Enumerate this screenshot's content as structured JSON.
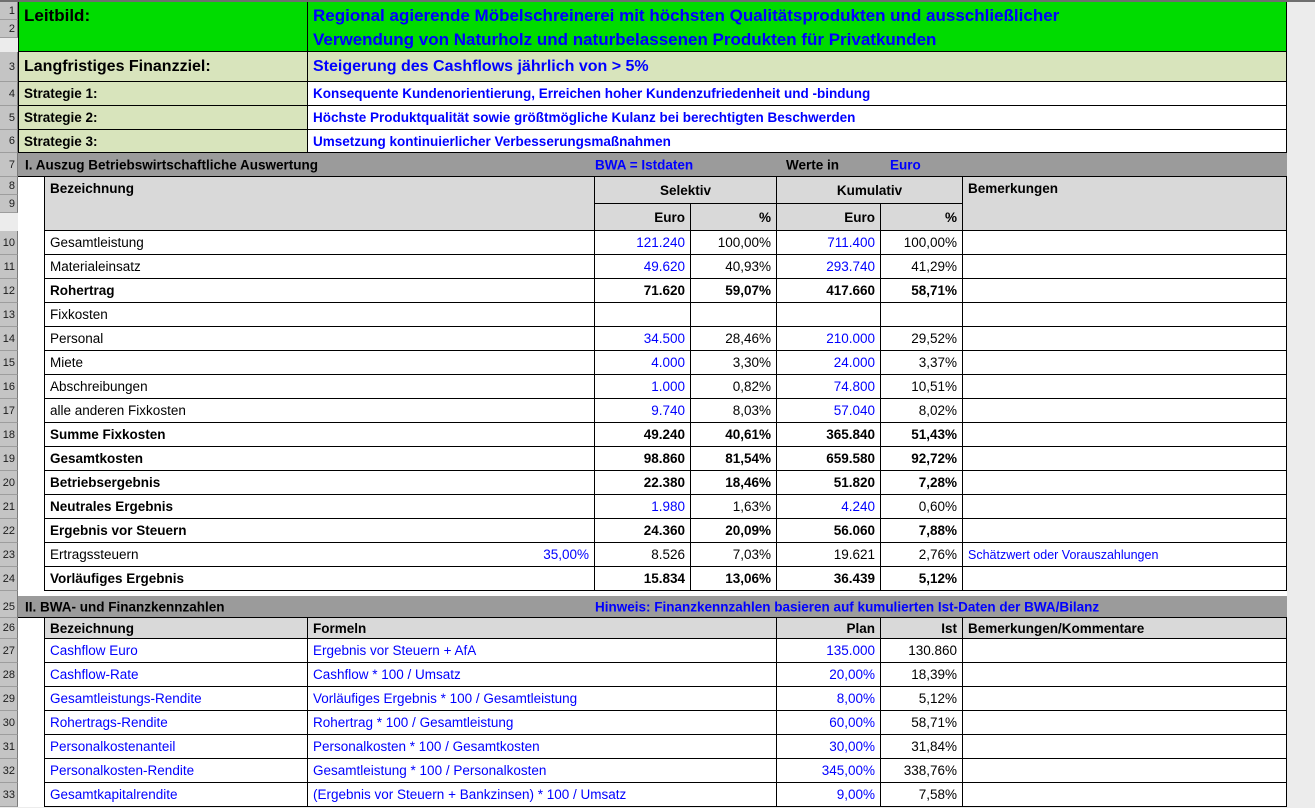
{
  "gutter": {
    "rows": [
      "1",
      "2",
      "3",
      "4",
      "5",
      "6",
      "7",
      "8",
      "9",
      "10",
      "11",
      "12",
      "13",
      "14",
      "15",
      "16",
      "17",
      "18",
      "19",
      "20",
      "21",
      "22",
      "23",
      "24",
      "25",
      "26",
      "27",
      "28",
      "29",
      "30",
      "31",
      "32",
      "33"
    ]
  },
  "colors": {
    "bright_green": "#00DC00",
    "light_green": "#D8E4BC",
    "section_bar_gray": "#9B9B9B",
    "table_header_gray": "#D9D9D9",
    "accent_blue": "#0000FF"
  },
  "top": {
    "leitbild": {
      "label": "Leitbild:",
      "line1": "Regional agierende Möbelschreinerei mit höchsten Qualitätsprodukten und ausschließlicher",
      "line2": "Verwendung von Naturholz und naturbelassenen Produkten für Privatkunden"
    },
    "finanzziel": {
      "label": "Langfristiges Finanzziel:",
      "text": "Steigerung des Cashflows jährlich von > 5%"
    },
    "strategien": [
      {
        "label": "Strategie 1:",
        "text": "Konsequente Kundenorientierung, Erreichen hoher Kundenzufriedenheit und -bindung"
      },
      {
        "label": "Strategie 2:",
        "text": "Höchste Produktqualität sowie größtmögliche Kulanz bei berechtigten Beschwerden"
      },
      {
        "label": "Strategie 3:",
        "text": "Umsetzung kontinuierlicher Verbesserungsmaßnahmen"
      }
    ]
  },
  "section1": {
    "title": "I. Auszug Betriebswirtschaftliche Auswertung",
    "note": "BWA = Istdaten",
    "werte_in_label": "Werte in",
    "werte_in_value": "Euro",
    "col_bezeichnung": "Bezeichnung",
    "col_selektiv": "Selektiv",
    "col_kumulativ": "Kumulativ",
    "col_bemerkungen": "Bemerkungen",
    "col_euro": "Euro",
    "col_pct": "%",
    "rows": [
      {
        "label": "Gesamtleistung",
        "se": "121.240",
        "sp": "100,00%",
        "ke": "711.400",
        "kp": "100,00%",
        "bem": ""
      },
      {
        "label": "Materialeinsatz",
        "se": "49.620",
        "sp": "40,93%",
        "ke": "293.740",
        "kp": "41,29%",
        "bem": ""
      },
      {
        "label": "Rohertrag",
        "se": "71.620",
        "sp": "59,07%",
        "ke": "417.660",
        "kp": "58,71%",
        "bem": ""
      },
      {
        "label": "Fixkosten",
        "se": "",
        "sp": "",
        "ke": "",
        "kp": "",
        "bem": ""
      },
      {
        "label": "Personal",
        "se": "34.500",
        "sp": "28,46%",
        "ke": "210.000",
        "kp": "29,52%",
        "bem": ""
      },
      {
        "label": "Miete",
        "se": "4.000",
        "sp": "3,30%",
        "ke": "24.000",
        "kp": "3,37%",
        "bem": ""
      },
      {
        "label": "Abschreibungen",
        "se": "1.000",
        "sp": "0,82%",
        "ke": "74.800",
        "kp": "10,51%",
        "bem": ""
      },
      {
        "label": "alle anderen Fixkosten",
        "se": "9.740",
        "sp": "8,03%",
        "ke": "57.040",
        "kp": "8,02%",
        "bem": ""
      },
      {
        "label": "Summe Fixkosten",
        "se": "49.240",
        "sp": "40,61%",
        "ke": "365.840",
        "kp": "51,43%",
        "bem": ""
      },
      {
        "label": "Gesamtkosten",
        "se": "98.860",
        "sp": "81,54%",
        "ke": "659.580",
        "kp": "92,72%",
        "bem": ""
      },
      {
        "label": "Betriebsergebnis",
        "se": "22.380",
        "sp": "18,46%",
        "ke": "51.820",
        "kp": "7,28%",
        "bem": ""
      },
      {
        "label": "Neutrales Ergebnis",
        "se": "1.980",
        "sp": "1,63%",
        "ke": "4.240",
        "kp": "0,60%",
        "bem": ""
      },
      {
        "label": "Ergebnis vor Steuern",
        "se": "24.360",
        "sp": "20,09%",
        "ke": "56.060",
        "kp": "7,88%",
        "bem": ""
      },
      {
        "label": "Ertragssteuern",
        "rate": "35,00%",
        "se": "8.526",
        "sp": "7,03%",
        "ke": "19.621",
        "kp": "2,76%",
        "bem": "Schätzwert oder Vorauszahlungen"
      },
      {
        "label": "Vorläufiges Ergebnis",
        "se": "15.834",
        "sp": "13,06%",
        "ke": "36.439",
        "kp": "5,12%",
        "bem": ""
      }
    ]
  },
  "section2": {
    "title": "II. BWA- und Finanzkennzahlen",
    "hint": "Hinweis: Finanzkennzahlen basieren auf kumulierten Ist-Daten der BWA/Bilanz",
    "col_bezeichnung": "Bezeichnung",
    "col_formeln": "Formeln",
    "col_plan": "Plan",
    "col_ist": "Ist",
    "col_bemerkungen": "Bemerkungen/Kommentare",
    "rows": [
      {
        "name": "Cashflow Euro",
        "formel": "Ergebnis vor Steuern + AfA",
        "plan": "135.000",
        "ist": "130.860",
        "bem": ""
      },
      {
        "name": "Cashflow-Rate",
        "formel": "Cashflow * 100 / Umsatz",
        "plan": "20,00%",
        "ist": "18,39%",
        "bem": ""
      },
      {
        "name": "Gesamtleistungs-Rendite",
        "formel": "Vorläufiges Ergebnis * 100 / Gesamtleistung",
        "plan": "8,00%",
        "ist": "5,12%",
        "bem": ""
      },
      {
        "name": "Rohertrags-Rendite",
        "formel": "Rohertrag * 100 / Gesamtleistung",
        "plan": "60,00%",
        "ist": "58,71%",
        "bem": ""
      },
      {
        "name": "Personalkostenanteil",
        "formel": "Personalkosten * 100 / Gesamtkosten",
        "plan": "30,00%",
        "ist": "31,84%",
        "bem": ""
      },
      {
        "name": "Personalkosten-Rendite",
        "formel": "Gesamtleistung * 100 / Personalkosten",
        "plan": "345,00%",
        "ist": "338,76%",
        "bem": ""
      },
      {
        "name": "Gesamtkapitalrendite",
        "formel": "(Ergebnis vor Steuern + Bankzinsen) * 100 / Umsatz",
        "plan": "9,00%",
        "ist": "7,58%",
        "bem": ""
      }
    ]
  }
}
